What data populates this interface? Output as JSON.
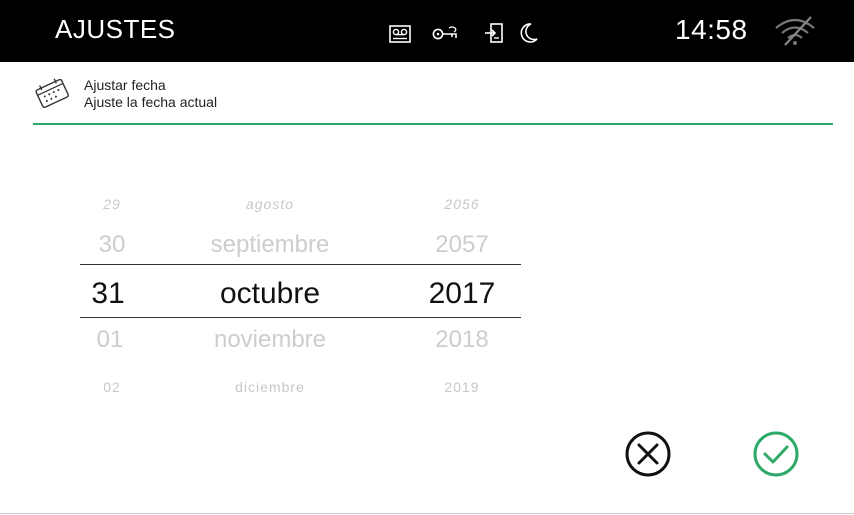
{
  "header": {
    "title": "AJUSTES",
    "clock": "14:58",
    "status_icons": [
      "intercom-icon",
      "key-icon",
      "door-exit-icon",
      "moon-icon"
    ],
    "wifi_icon": "wifi-off-icon"
  },
  "section": {
    "icon": "calendar-icon",
    "title": "Ajustar fecha",
    "subtitle": "Ajuste la fecha actual"
  },
  "picker": {
    "days": [
      "29",
      "30",
      "31",
      "01",
      "02"
    ],
    "months": [
      "agosto",
      "septiembre",
      "octubre",
      "noviembre",
      "diciembre"
    ],
    "years": [
      "2056",
      "2057",
      "2017",
      "2018",
      "2019"
    ],
    "selected": {
      "day": "31",
      "month": "octubre",
      "year": "2017"
    }
  },
  "actions": {
    "cancel_icon": "cancel-icon",
    "confirm_icon": "confirm-icon"
  },
  "colors": {
    "accent": "#2eaa68",
    "topbar": "#000000",
    "inactive_text": "#cdcdcd"
  }
}
